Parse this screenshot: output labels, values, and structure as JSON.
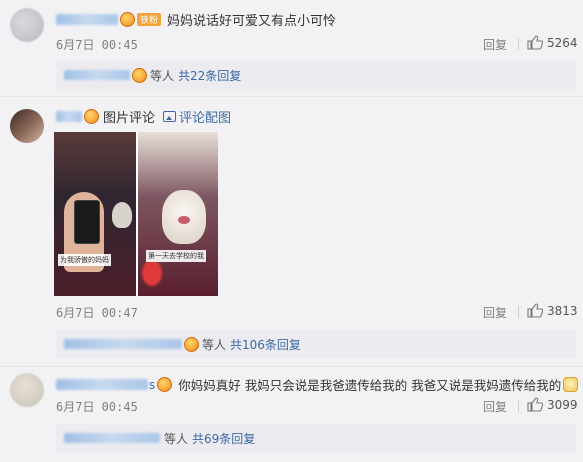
{
  "comments": [
    {
      "text": "妈妈说话好可爱又有点小可怜",
      "fan_badge": "铁粉",
      "time": "6月7日 00:45",
      "reply_label": "回复",
      "likes": "5264",
      "replies_summary": {
        "prefix": "等人",
        "link": "共22条回复"
      }
    },
    {
      "text": "图片评论",
      "image_link": "评论配图",
      "time": "6月7日 00:47",
      "reply_label": "回复",
      "likes": "3813",
      "image_captions": [
        "为我骄傲的妈妈",
        "第一天去学校的我"
      ],
      "replies_summary": {
        "prefix": "等人",
        "link": "共106条回复"
      }
    },
    {
      "name_suffix": "s",
      "text": "你妈妈真好 我妈只会说是我爸遗传给我的 我爸又说是我妈遗传给我的",
      "time": "6月7日 00:45",
      "reply_label": "回复",
      "likes": "3099",
      "replies_summary": {
        "prefix": "等人",
        "link": "共69条回复"
      }
    }
  ],
  "colors": {
    "link": "#3b6aa8",
    "meta": "#808080",
    "background": "#f2f2f5"
  }
}
